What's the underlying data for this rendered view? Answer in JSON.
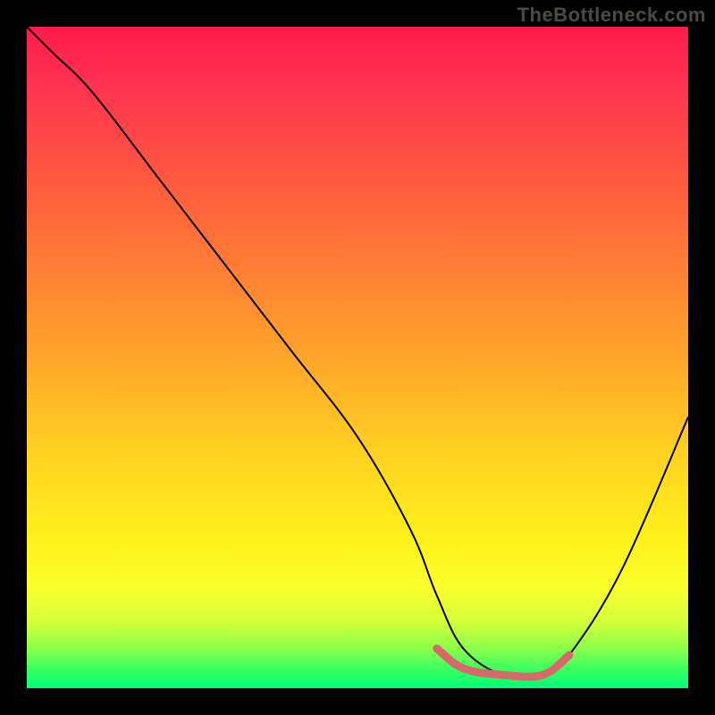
{
  "watermark": "TheBottleneck.com",
  "chart_data": {
    "type": "line",
    "title": "",
    "xlabel": "",
    "ylabel": "",
    "xlim": [
      0,
      100
    ],
    "ylim": [
      0,
      100
    ],
    "grid": false,
    "legend": false,
    "background_gradient": {
      "top": "#ff1a4d",
      "mid": "#ffe01e",
      "bottom": "#00ff78"
    },
    "series": [
      {
        "name": "bottleneck-curve",
        "color": "#000000",
        "x": [
          0,
          4,
          10,
          20,
          30,
          40,
          50,
          58,
          62,
          66,
          72,
          78,
          82,
          90,
          100
        ],
        "y": [
          100,
          96,
          90,
          77,
          64,
          51,
          38,
          24,
          14,
          6,
          2,
          2,
          5,
          18,
          41
        ]
      }
    ],
    "highlight_segment": {
      "name": "optimal-range",
      "color": "#d46a6a",
      "x": [
        62,
        66,
        72,
        78,
        82
      ],
      "y": [
        6,
        3,
        2,
        2,
        5
      ]
    }
  }
}
